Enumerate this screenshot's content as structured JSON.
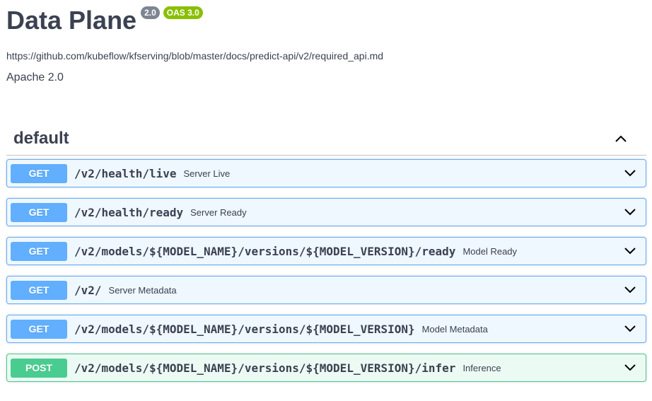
{
  "info": {
    "title": "Data Plane",
    "version_badge": "2.0",
    "oas_badge": "OAS 3.0",
    "spec_url": "https://github.com/kubeflow/kfserving/blob/master/docs/predict-api/v2/required_api.md",
    "license": "Apache 2.0"
  },
  "section": {
    "name": "default",
    "expanded": true,
    "icon": "chevron-up-icon"
  },
  "colors": {
    "get": "#61affe",
    "post": "#49cc90",
    "text": "#3b4151",
    "version_badge": "#7d8492",
    "oas_badge": "#89bf04"
  },
  "operations": [
    {
      "method": "GET",
      "path": "/v2/health/live",
      "summary": "Server Live"
    },
    {
      "method": "GET",
      "path": "/v2/health/ready",
      "summary": "Server Ready"
    },
    {
      "method": "GET",
      "path": "/v2/models/${MODEL_NAME}/versions/${MODEL_VERSION}/ready",
      "summary": "Model Ready"
    },
    {
      "method": "GET",
      "path": "/v2/",
      "summary": "Server Metadata"
    },
    {
      "method": "GET",
      "path": "/v2/models/${MODEL_NAME}/versions/${MODEL_VERSION}",
      "summary": "Model Metadata"
    },
    {
      "method": "POST",
      "path": "/v2/models/${MODEL_NAME}/versions/${MODEL_VERSION}/infer",
      "summary": "Inference"
    }
  ]
}
